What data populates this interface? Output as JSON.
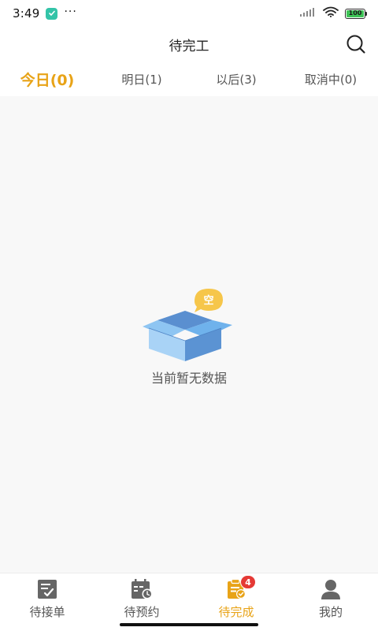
{
  "status_bar": {
    "time": "3:49",
    "dots": "···",
    "battery": "100",
    "colors": {
      "battery_fill": "#3ec456",
      "app_badge": "#33c4a8"
    }
  },
  "header": {
    "title": "待完工",
    "search_icon": "search-icon"
  },
  "tabs": [
    {
      "label": "今日(0)",
      "active": true
    },
    {
      "label": "明日(1)",
      "active": false
    },
    {
      "label": "以后(3)",
      "active": false
    },
    {
      "label": "取消中(0)",
      "active": false
    }
  ],
  "empty_state": {
    "bubble_text": "空",
    "message": "当前暂无数据",
    "icon": "empty-box-icon"
  },
  "bottom_nav": [
    {
      "label": "待接单",
      "icon": "checklist-icon",
      "active": false
    },
    {
      "label": "待预约",
      "icon": "calendar-clock-icon",
      "active": false
    },
    {
      "label": "待完成",
      "icon": "clipboard-check-icon",
      "active": true,
      "badge": "4"
    },
    {
      "label": "我的",
      "icon": "user-icon",
      "active": false
    }
  ],
  "colors": {
    "accent": "#e8a317",
    "badge": "#e53935",
    "content_bg": "#f8f8f8"
  }
}
